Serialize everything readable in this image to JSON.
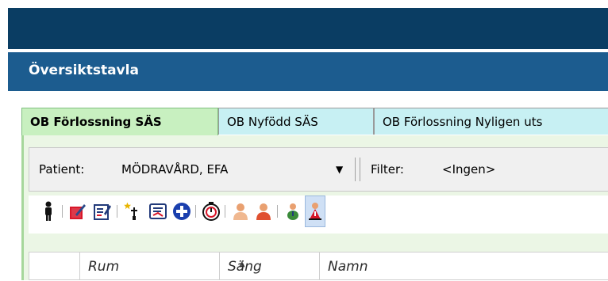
{
  "header": {
    "title": "Översiktstavla"
  },
  "tabs": [
    {
      "label": "OB Förlossning SÄS",
      "active": true
    },
    {
      "label": "OB Nyfödd SÄS",
      "active": false
    },
    {
      "label": "OB Förlossning Nyligen uts",
      "active": false
    }
  ],
  "filterbar": {
    "patient_label": "Patient:",
    "patient_value": "MÖDRAVÅRD, EFA",
    "filter_label": "Filter:",
    "filter_value": "<Ingen>"
  },
  "toolbar": {
    "icons": [
      "person-icon",
      "edit-note-icon",
      "form-icon",
      "new-item-icon",
      "scroll-icon",
      "add-circle-icon",
      "timer-icon",
      "user-icon",
      "remove-user-icon",
      "baby-icon",
      "person-alert-icon"
    ]
  },
  "grid": {
    "columns": [
      "Rum",
      "Säng",
      "Namn"
    ]
  },
  "colors": {
    "topbar": "#0a3d63",
    "titlebar": "#1c5c8f",
    "active_tab": "#c8f0c0",
    "inactive_tab": "#c7f0f3"
  }
}
